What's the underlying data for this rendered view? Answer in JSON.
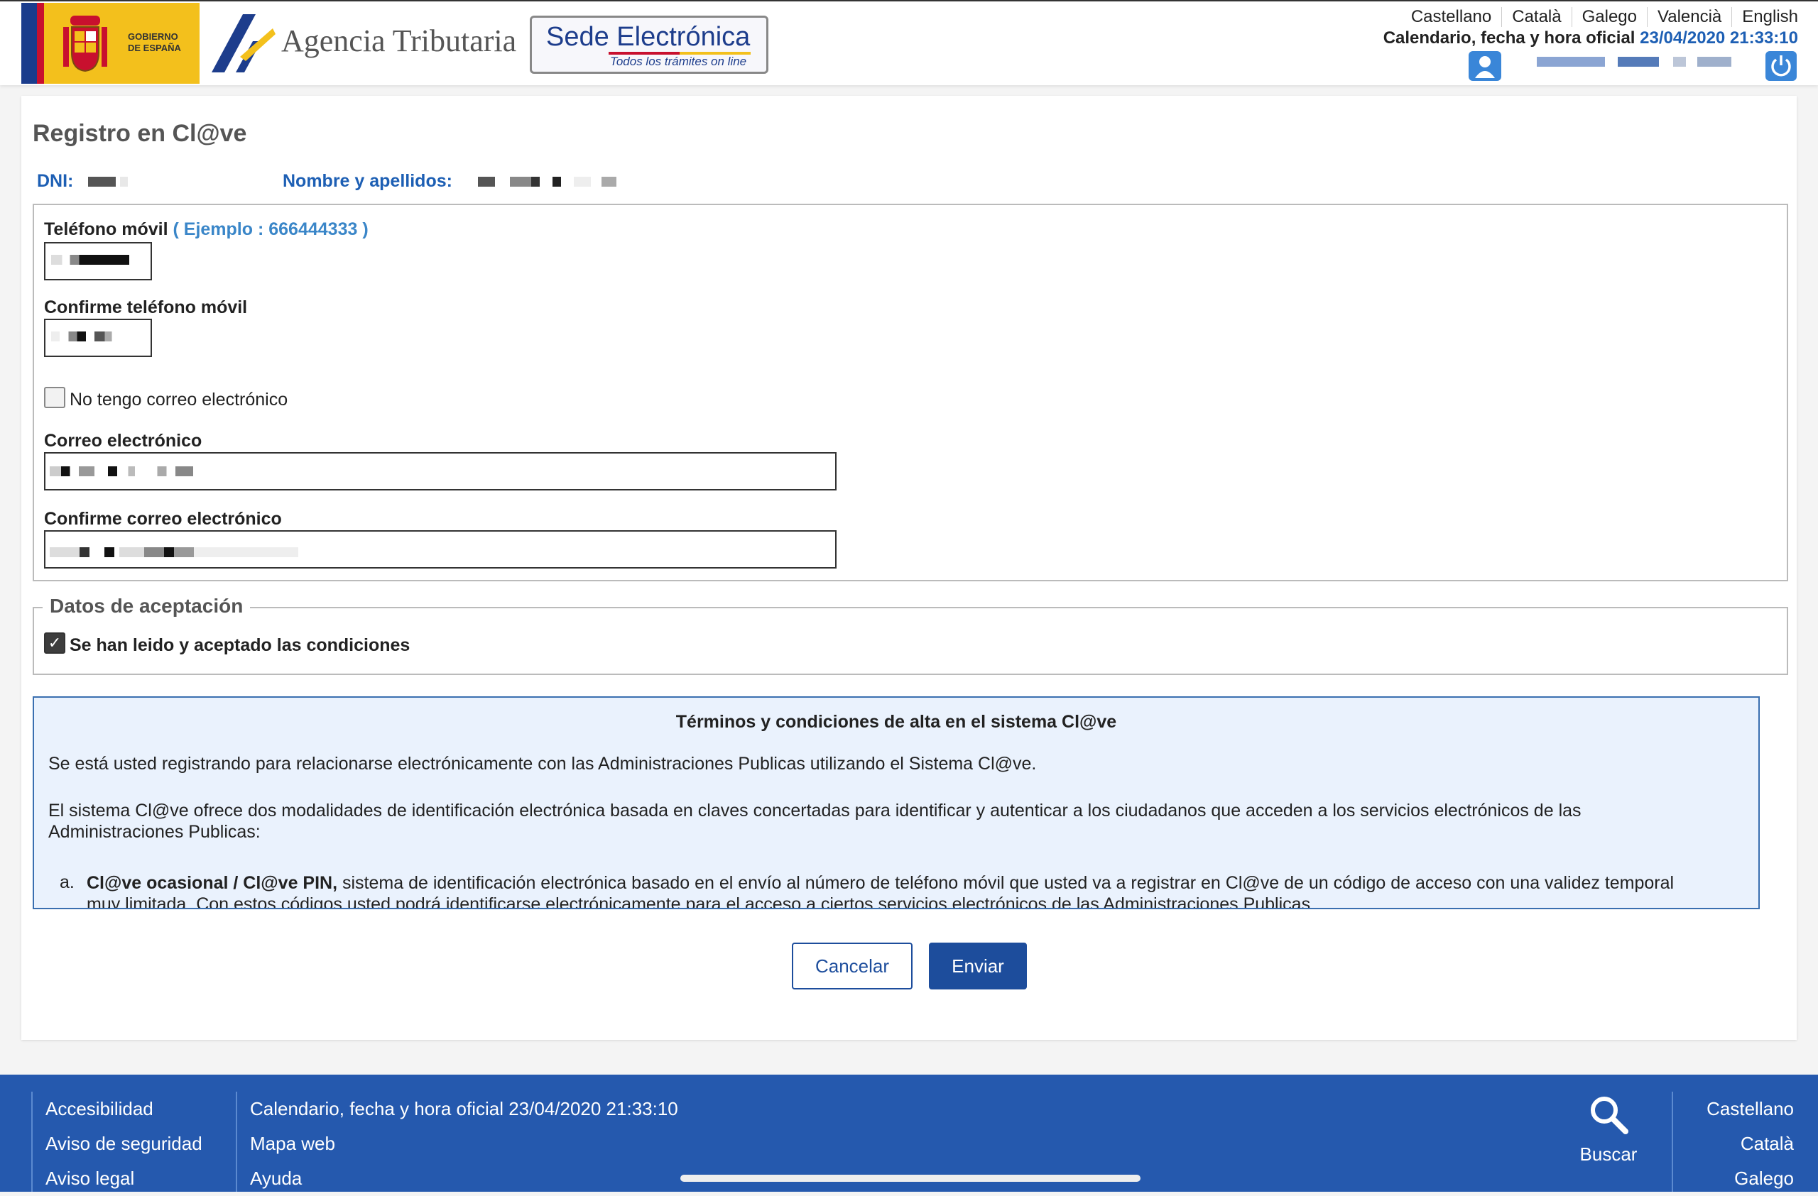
{
  "header": {
    "gobierno_text": "GOBIERNO DE ESPAÑA",
    "agency_name": "Agencia Tributaria",
    "sede_title": "Sede Electrónica",
    "sede_subtitle": "Todos los trámites on line",
    "languages": [
      "Castellano",
      "Català",
      "Galego",
      "Valencià",
      "English"
    ],
    "calendar_label": "Calendario, fecha y hora oficial",
    "calendar_datetime": "23/04/2020 21:33:10",
    "user_icon": "user-icon",
    "logout_icon": "power-icon"
  },
  "page": {
    "title": "Registro en Cl@ve",
    "dni_label": "DNI:",
    "name_label": "Nombre y apellidos:"
  },
  "form": {
    "phone_label": "Teléfono móvil",
    "phone_example": "( Ejemplo : 666444333 )",
    "phone_confirm_label": "Confirme teléfono móvil",
    "no_email_label": "No tengo correo electrónico",
    "no_email_checked": false,
    "email_label": "Correo electrónico",
    "email_confirm_label": "Confirme correo electrónico"
  },
  "acceptance": {
    "legend": "Datos de aceptación",
    "accepted_label": "Se han leido y aceptado las condiciones",
    "accepted_checked": true
  },
  "terms": {
    "title": "Términos y condiciones de alta en el sistema Cl@ve",
    "p1": "Se está usted registrando para relacionarse electrónicamente con las Administraciones Publicas utilizando el Sistema Cl@ve.",
    "p2": "El sistema Cl@ve ofrece dos modalidades de identificación electrónica basada en claves concertadas para identificar y autenticar a los ciudadanos que acceden a los servicios electrónicos de las Administraciones Publicas:",
    "item_marker": "a.",
    "item_a_bold": "Cl@ve ocasional / Cl@ve PIN,",
    "item_a_text": " sistema de identificación electrónica basado en el envío al número de teléfono móvil que usted va a registrar en Cl@ve de un código de acceso con una validez temporal muy limitada. Con estos códigos usted podrá identificarse electrónicamente para el acceso a ciertos servicios electrónicos de las Administraciones Publicas."
  },
  "buttons": {
    "cancel": "Cancelar",
    "send": "Enviar"
  },
  "footer": {
    "col1": [
      "Accesibilidad",
      "Aviso de seguridad",
      "Aviso legal"
    ],
    "col2": [
      "Calendario, fecha y hora oficial 23/04/2020 21:33:10",
      "Mapa web",
      "Ayuda"
    ],
    "search_label": "Buscar",
    "languages": [
      "Castellano",
      "Català",
      "Galego"
    ]
  },
  "colors": {
    "brand_blue": "#1d4d9c",
    "footer_blue": "#2559ae",
    "link_blue": "#1d5fb4",
    "terms_bg": "#eaf2fd"
  }
}
